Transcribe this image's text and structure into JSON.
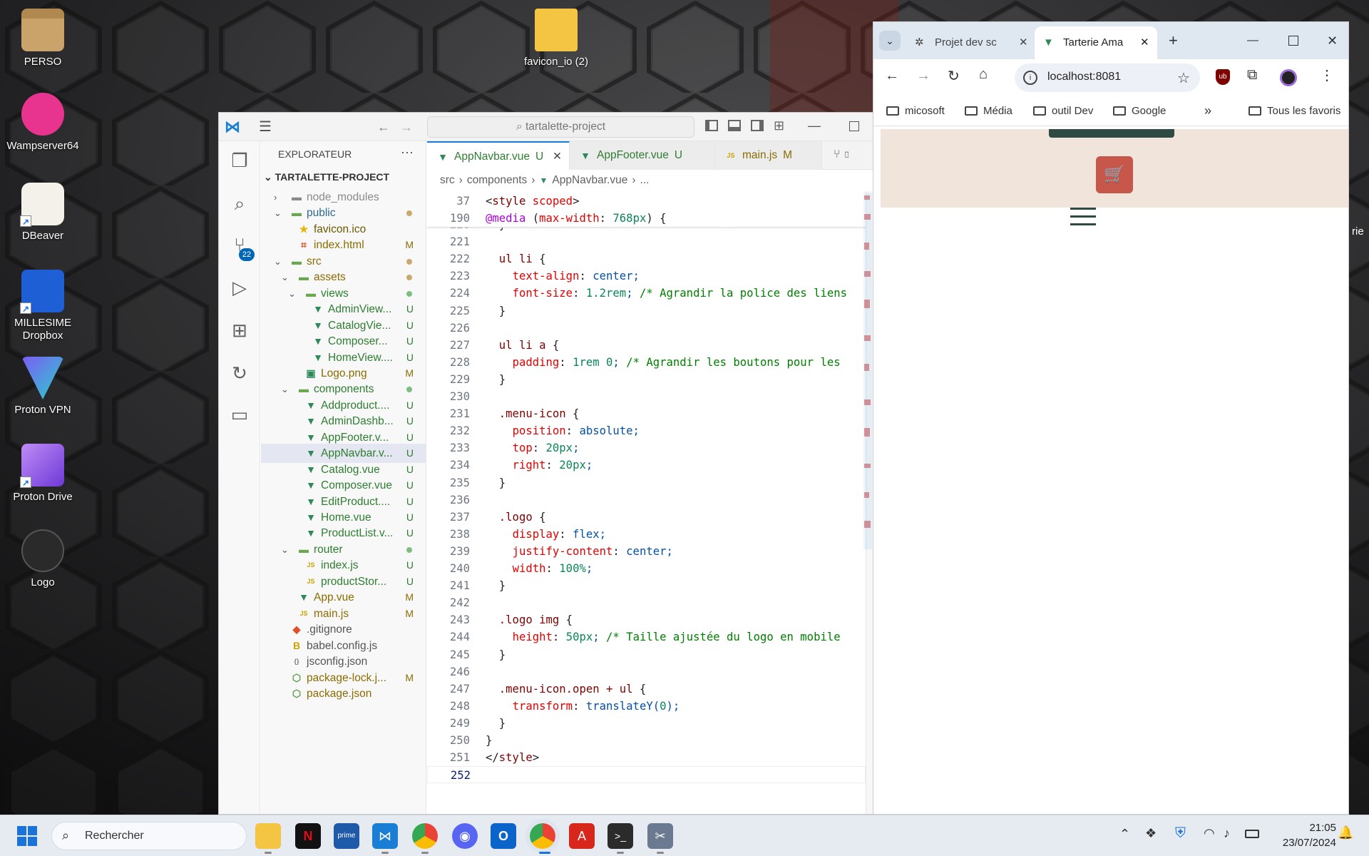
{
  "desktop": {
    "icons": [
      {
        "label": "PERSO",
        "icon": "archive-box-icon"
      },
      {
        "label": "favicon_io (2)",
        "icon": "zip-folder-icon"
      },
      {
        "label": "Wampserver64",
        "icon": "wampserver-icon"
      },
      {
        "label": "DBeaver",
        "icon": "dbeaver-icon"
      },
      {
        "label": "MILLESIME Dropbox",
        "icon": "dropbox-icon"
      },
      {
        "label": "Proton VPN",
        "icon": "proton-vpn-icon"
      },
      {
        "label": "Proton Drive",
        "icon": "proton-drive-icon"
      },
      {
        "label": "Logo",
        "icon": "logo-image-icon"
      }
    ],
    "behind_text": "rie"
  },
  "vscode": {
    "search_text": "tartalette-project",
    "explorer_title": "EXPLORATEUR",
    "scm_badge": "22",
    "project_title": "TARTALETTE-PROJECT",
    "tree": [
      {
        "label": "node_modules",
        "depth": 1,
        "kind": "folder-closed",
        "status": "",
        "color": "#8a8a8a"
      },
      {
        "label": "public",
        "depth": 1,
        "kind": "folder-open",
        "status": "dot",
        "color": "#2b6a8f"
      },
      {
        "label": "favicon.ico",
        "depth": 2,
        "kind": "star",
        "status": "",
        "color": "#6b5a00"
      },
      {
        "label": "index.html",
        "depth": 2,
        "kind": "html",
        "status": "M",
        "color": "#8a6d00"
      },
      {
        "label": "src",
        "depth": 1,
        "kind": "folder-open",
        "status": "dot",
        "color": "#8a6d00"
      },
      {
        "label": "assets",
        "depth": 2,
        "kind": "folder-open",
        "status": "dot",
        "color": "#8a6d00"
      },
      {
        "label": "views",
        "depth": 3,
        "kind": "folder-open",
        "status": "dot-green",
        "color": "#2f7d32"
      },
      {
        "label": "AdminView...",
        "depth": 4,
        "kind": "vue",
        "status": "U",
        "color": "#2f7d32"
      },
      {
        "label": "CatalogVie...",
        "depth": 4,
        "kind": "vue",
        "status": "U",
        "color": "#2f7d32"
      },
      {
        "label": "Composer...",
        "depth": 4,
        "kind": "vue",
        "status": "U",
        "color": "#2f7d32"
      },
      {
        "label": "HomeView....",
        "depth": 4,
        "kind": "vue",
        "status": "U",
        "color": "#2f7d32"
      },
      {
        "label": "Logo.png",
        "depth": 3,
        "kind": "image",
        "status": "M",
        "color": "#8a6d00"
      },
      {
        "label": "components",
        "depth": 2,
        "kind": "folder-open",
        "status": "dot-green",
        "color": "#2f7d32"
      },
      {
        "label": "Addproduct....",
        "depth": 3,
        "kind": "vue",
        "status": "U",
        "color": "#2f7d32"
      },
      {
        "label": "AdminDashb...",
        "depth": 3,
        "kind": "vue",
        "status": "U",
        "color": "#2f7d32"
      },
      {
        "label": "AppFooter.v...",
        "depth": 3,
        "kind": "vue",
        "status": "U",
        "color": "#2f7d32"
      },
      {
        "label": "AppNavbar.v...",
        "depth": 3,
        "kind": "vue",
        "status": "U",
        "color": "#2f7d32",
        "selected": true
      },
      {
        "label": "Catalog.vue",
        "depth": 3,
        "kind": "vue",
        "status": "U",
        "color": "#2f7d32"
      },
      {
        "label": "Composer.vue",
        "depth": 3,
        "kind": "vue",
        "status": "U",
        "color": "#2f7d32"
      },
      {
        "label": "EditProduct....",
        "depth": 3,
        "kind": "vue",
        "status": "U",
        "color": "#2f7d32"
      },
      {
        "label": "Home.vue",
        "depth": 3,
        "kind": "vue",
        "status": "U",
        "color": "#2f7d32"
      },
      {
        "label": "ProductList.v...",
        "depth": 3,
        "kind": "vue",
        "status": "U",
        "color": "#2f7d32"
      },
      {
        "label": "router",
        "depth": 2,
        "kind": "folder-open",
        "status": "dot-green",
        "color": "#2f7d32"
      },
      {
        "label": "index.js",
        "depth": 3,
        "kind": "js",
        "status": "U",
        "color": "#2f7d32"
      },
      {
        "label": "productStor...",
        "depth": 3,
        "kind": "js",
        "status": "U",
        "color": "#2f7d32"
      },
      {
        "label": "App.vue",
        "depth": 2,
        "kind": "vue",
        "status": "M",
        "color": "#8a6d00"
      },
      {
        "label": "main.js",
        "depth": 2,
        "kind": "js",
        "status": "M",
        "color": "#8a6d00"
      },
      {
        "label": ".gitignore",
        "depth": 1,
        "kind": "git",
        "status": "",
        "color": "#555555"
      },
      {
        "label": "babel.config.js",
        "depth": 1,
        "kind": "babel",
        "status": "",
        "color": "#555555"
      },
      {
        "label": "jsconfig.json",
        "depth": 1,
        "kind": "json",
        "status": "",
        "color": "#555555"
      },
      {
        "label": "package-lock.j...",
        "depth": 1,
        "kind": "node",
        "status": "M",
        "color": "#8a6d00"
      },
      {
        "label": "package.json",
        "depth": 1,
        "kind": "node",
        "status": "",
        "color": "#8a6d00"
      }
    ],
    "tabs": [
      {
        "label": "AppNavbar.vue",
        "status": "U",
        "icon": "vue",
        "active": true
      },
      {
        "label": "AppFooter.vue",
        "status": "U",
        "icon": "vue",
        "active": false
      },
      {
        "label": "main.js",
        "status": "M",
        "icon": "js",
        "active": false
      }
    ],
    "breadcrumb": [
      "src",
      "components",
      "AppNavbar.vue",
      "..."
    ],
    "sticky_lines": [
      {
        "n": "37",
        "code": "<style scoped>"
      },
      {
        "n": "190",
        "code": "@media (max-width: 768px) {"
      }
    ],
    "lines": [
      {
        "n": "220",
        "code": "  }"
      },
      {
        "n": "221",
        "code": ""
      },
      {
        "n": "222",
        "code": "  ul li {"
      },
      {
        "n": "223",
        "code": "    text-align: center;"
      },
      {
        "n": "224",
        "code": "    font-size: 1.2rem; /* Agrandir la police des liens"
      },
      {
        "n": "225",
        "code": "  }"
      },
      {
        "n": "226",
        "code": ""
      },
      {
        "n": "227",
        "code": "  ul li a {"
      },
      {
        "n": "228",
        "code": "    padding: 1rem 0; /* Agrandir les boutons pour les"
      },
      {
        "n": "229",
        "code": "  }"
      },
      {
        "n": "230",
        "code": ""
      },
      {
        "n": "231",
        "code": "  .menu-icon {"
      },
      {
        "n": "232",
        "code": "    position: absolute;"
      },
      {
        "n": "233",
        "code": "    top: 20px;"
      },
      {
        "n": "234",
        "code": "    right: 20px;"
      },
      {
        "n": "235",
        "code": "  }"
      },
      {
        "n": "236",
        "code": ""
      },
      {
        "n": "237",
        "code": "  .logo {"
      },
      {
        "n": "238",
        "code": "    display: flex;"
      },
      {
        "n": "239",
        "code": "    justify-content: center;"
      },
      {
        "n": "240",
        "code": "    width: 100%;"
      },
      {
        "n": "241",
        "code": "  }"
      },
      {
        "n": "242",
        "code": ""
      },
      {
        "n": "243",
        "code": "  .logo img {"
      },
      {
        "n": "244",
        "code": "    height: 50px; /* Taille ajustée du logo en mobile"
      },
      {
        "n": "245",
        "code": "  }"
      },
      {
        "n": "246",
        "code": ""
      },
      {
        "n": "247",
        "code": "  .menu-icon.open + ul {"
      },
      {
        "n": "248",
        "code": "    transform: translateY(0);"
      },
      {
        "n": "249",
        "code": "  }"
      },
      {
        "n": "250",
        "code": "}"
      },
      {
        "n": "251",
        "code": "</style>"
      },
      {
        "n": "252",
        "code": ""
      }
    ]
  },
  "chrome": {
    "tabs": [
      {
        "label": "Projet dev sc",
        "icon": "chatgpt-icon"
      },
      {
        "label": "Tarterie Ama",
        "icon": "vue-icon"
      }
    ],
    "url": "localhost:8081",
    "bookmarks": [
      "micosoft",
      "Média",
      "outil Dev",
      "Google"
    ],
    "all_bookmarks": "Tous les favoris",
    "colors": {
      "page_header": "#f1e4da",
      "cart_button": "#c6574a",
      "dark_green": "#2f4a43"
    }
  },
  "taskbar": {
    "search_placeholder": "Rechercher",
    "time": "21:05",
    "date": "23/07/2024",
    "apps": [
      "file-explorer-icon",
      "netflix-icon",
      "prime-video-icon",
      "vscode-icon",
      "chrome-icon",
      "discord-icon",
      "outlook-icon",
      "chrome-icon",
      "acrobat-icon",
      "terminal-icon",
      "snipping-tool-icon"
    ]
  }
}
